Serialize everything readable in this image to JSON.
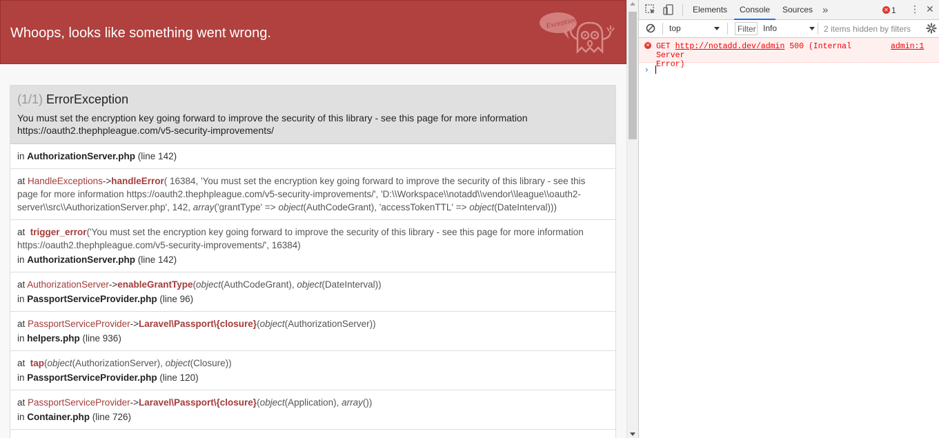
{
  "banner": {
    "title": "Whoops, looks like something went wrong.",
    "mascot_label": "Exception!"
  },
  "exception": {
    "count": "(1/1)",
    "type": "ErrorException",
    "message_line1": "You must set the encryption key going forward to improve the security of this library - see this page for more information",
    "message_line2": "https://oauth2.thephpleague.com/v5-security-improvements/"
  },
  "trace": {
    "r0": {
      "in": "in ",
      "file": "AuthorizationServer.php",
      "line": " (line 142)"
    },
    "r1": {
      "at": "at ",
      "cls": "HandleExceptions",
      "arrow": "->",
      "fn": "handleError",
      "args_a": "( 16384, 'You must set the encryption key going forward to improve the security of this library - see this page for more information https://oauth2.thephpleague.com/v5-security-improvements/', 'D:\\\\Workspace\\\\notadd\\\\vendor\\\\league\\\\oauth2-server\\\\src\\\\AuthorizationServer.php', 142, ",
      "kw_array": "array",
      "args_b": "('grantType' => ",
      "kw_object1": "object",
      "args_c": "(AuthCodeGrant), 'accessTokenTTL' => ",
      "kw_object2": "object",
      "args_d": "(DateInterval)))"
    },
    "r2": {
      "at": "at ",
      "fn": "trigger_error",
      "args": "('You must set the encryption key going forward to improve the security of this library - see this page for more information https://oauth2.thephpleague.com/v5-security-improvements/', 16384)",
      "in": "in ",
      "file": "AuthorizationServer.php",
      "line": " (line 142)"
    },
    "r3": {
      "at": "at ",
      "cls": "AuthorizationServer",
      "arrow": "->",
      "fn": "enableGrantType",
      "open": "(",
      "kw_object1": "object",
      "a1": "(AuthCodeGrant), ",
      "kw_object2": "object",
      "a2": "(DateInterval))",
      "in": "in ",
      "file": "PassportServiceProvider.php",
      "line": " (line 96)"
    },
    "r4": {
      "at": "at ",
      "cls": "PassportServiceProvider",
      "arrow": "->",
      "fn": "Laravel\\Passport\\{closure}",
      "open": "(",
      "kw_object1": "object",
      "a1": "(AuthorizationServer))",
      "in": "in ",
      "file": "helpers.php",
      "line": " (line 936)"
    },
    "r5": {
      "at": "at ",
      "fn": "tap",
      "open": "(",
      "kw_object1": "object",
      "a1": "(AuthorizationServer), ",
      "kw_object2": "object",
      "a2": "(Closure))",
      "in": "in ",
      "file": "PassportServiceProvider.php",
      "line": " (line 120)"
    },
    "r6": {
      "at": "at ",
      "cls": "PassportServiceProvider",
      "arrow": "->",
      "fn": "Laravel\\Passport\\{closure}",
      "open": "(",
      "kw_object1": "object",
      "a1": "(Application), ",
      "kw_array": "array",
      "a2": "())",
      "in": "in ",
      "file": "Container.php",
      "line": " (line 726)"
    }
  },
  "devtools": {
    "tabs": [
      "Elements",
      "Console",
      "Sources"
    ],
    "more_tabs": "»",
    "error_badge_count": "1",
    "context": "top",
    "filter_placeholder": "Filter",
    "level": "Info",
    "hidden_count": "2 items hidden by filters",
    "console": {
      "method": "GET",
      "url": "http://notadd.dev/admin",
      "status_line1": "500 (Internal Server",
      "status_line2": "Error)",
      "source": "admin:1",
      "prompt_symbol": "›"
    },
    "accent": "#1a73e8",
    "error_color": "#e0362c"
  },
  "colors": {
    "banner_bg": "#b0413e",
    "trace_highlight": "#a33c3a"
  }
}
